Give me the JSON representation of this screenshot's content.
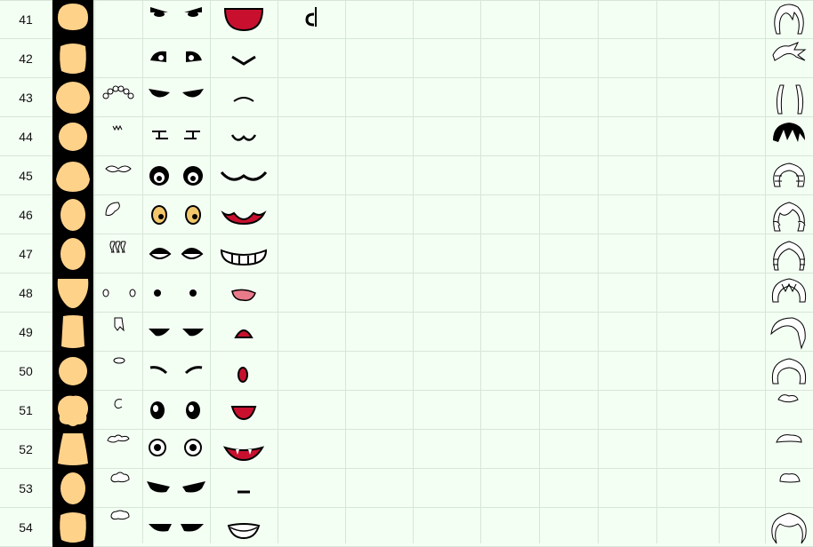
{
  "sheet": {
    "rows": [
      {
        "num": "41",
        "face": "round-top",
        "extra": "none",
        "eyes": "angry-lashes",
        "mouth": "big-open",
        "misc": "cent-sign",
        "hair": "long-wavy"
      },
      {
        "num": "42",
        "face": "tall-round",
        "extra": "none",
        "eyes": "slanted-dark",
        "mouth": "v-frown",
        "misc": "none",
        "hair": "spiky-side"
      },
      {
        "num": "43",
        "face": "wide-round",
        "extra": "curls-row",
        "eyes": "squint-lashes",
        "mouth": "small-arc",
        "misc": "none",
        "hair": "side-curtains"
      },
      {
        "num": "44",
        "face": "circle",
        "extra": "tiny-scribble",
        "eyes": "flat-lines",
        "mouth": "w-smile",
        "misc": "none",
        "hair": "black-spiky"
      },
      {
        "num": "45",
        "face": "wide-oval",
        "extra": "mustache",
        "eyes": "big-angry-round",
        "mouth": "wave-smile",
        "misc": "none",
        "hair": "puffy-curls"
      },
      {
        "num": "46",
        "face": "oval",
        "extra": "curl",
        "eyes": "yellow-round",
        "mouth": "red-smile",
        "misc": "none",
        "hair": "curly-sides"
      },
      {
        "num": "47",
        "face": "oval",
        "extra": "wavy-lines",
        "eyes": "half-lid",
        "mouth": "teeth-grin",
        "misc": "none",
        "hair": "braids"
      },
      {
        "num": "48",
        "face": "pointed",
        "extra": "small-circles",
        "eyes": "dots",
        "mouth": "pink-lips",
        "misc": "none",
        "hair": "bob-m"
      },
      {
        "num": "49",
        "face": "narrow",
        "extra": "tooth-shape",
        "eyes": "sleepy-dark",
        "mouth": "red-triangle",
        "misc": "none",
        "hair": "swoop"
      },
      {
        "num": "50",
        "face": "circle",
        "extra": "tiny-oval",
        "eyes": "brows-only",
        "mouth": "red-o",
        "misc": "none",
        "hair": "wavy-short"
      },
      {
        "num": "51",
        "face": "bumpy",
        "extra": "hook",
        "eyes": "tall-dark",
        "mouth": "red-half",
        "misc": "none",
        "hair": "tiny-tuft"
      },
      {
        "num": "52",
        "face": "trapezoid",
        "extra": "cloud-line",
        "eyes": "big-pupils",
        "mouth": "fang-smile",
        "misc": "none",
        "hair": "small-dome"
      },
      {
        "num": "53",
        "face": "oval",
        "extra": "cloud",
        "eyes": "fierce-wing",
        "mouth": "dash",
        "misc": "none",
        "hair": "cloud-puff"
      },
      {
        "num": "54",
        "face": "tall-round",
        "extra": "cloud-small",
        "eyes": "fierce-lashes",
        "mouth": "teeth-mouth",
        "misc": "none",
        "hair": "curly-afro"
      }
    ]
  }
}
